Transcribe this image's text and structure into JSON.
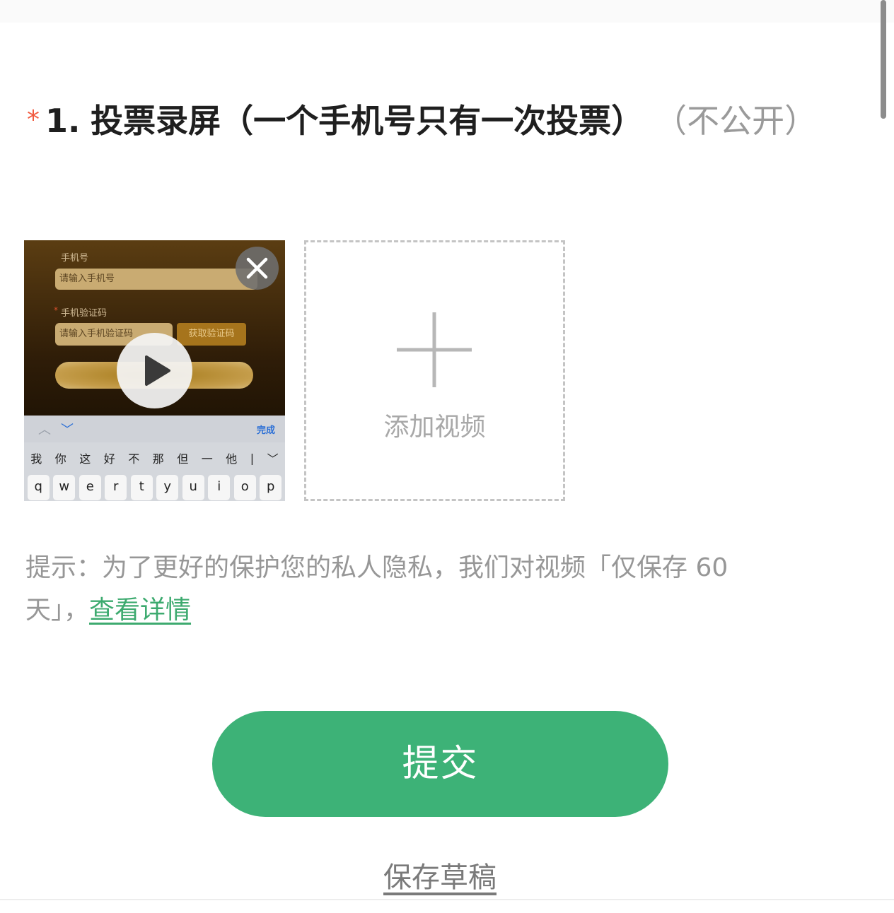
{
  "question": {
    "required_mark": "*",
    "number": "1.",
    "title": "投票录屏（一个手机号只有一次投票）",
    "note": "（不公开）"
  },
  "video_thumbnail": {
    "phone_label": "手机号",
    "phone_placeholder": "请输入手机号",
    "required_mark": "*",
    "code_label": "手机验证码",
    "code_placeholder": "请输入手机验证码",
    "get_code_label": "获取验证码",
    "keyboard_done": "完成",
    "candidates": [
      "我",
      "你",
      "这",
      "好",
      "不",
      "那",
      "但",
      "一",
      "他",
      "|",
      "﹀"
    ],
    "keys": [
      "q",
      "w",
      "e",
      "r",
      "t",
      "y",
      "u",
      "i",
      "o",
      "p"
    ]
  },
  "add_video": {
    "label": "添加视频"
  },
  "hint": {
    "text": "提示：为了更好的保护您的私人隐私，我们对视频「仅保存 60 天」，",
    "link": "查看详情"
  },
  "actions": {
    "submit_label": "提交",
    "save_draft_label": "保存草稿"
  },
  "colors": {
    "accent": "#3db277",
    "link": "#3daa6f",
    "required": "#f15a3f"
  }
}
